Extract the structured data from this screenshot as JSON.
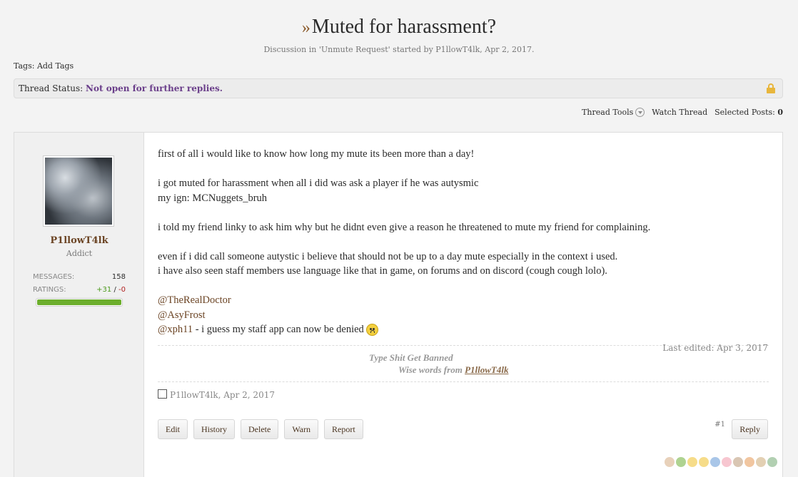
{
  "thread": {
    "prefix": "»",
    "title": "Muted for harassment?",
    "discussion_prefix": "Discussion in '",
    "forum": "Unmute Request",
    "started_by_prefix": "' started by ",
    "author": "P1llowT4lk",
    "date_sep": ", ",
    "date": "Apr 2, 2017",
    "date_end": "."
  },
  "tags": {
    "label": "Tags:",
    "add_label": "Add Tags"
  },
  "status": {
    "label": "Thread Status:",
    "value": "Not open for further replies."
  },
  "tools": {
    "thread_tools": "Thread Tools",
    "watch": "Watch Thread",
    "selected_label": "Selected Posts:",
    "selected_count": "0"
  },
  "user": {
    "name": "P1llowT4lk",
    "title": "Addict",
    "messages_label": "MESSAGES:",
    "messages": "158",
    "ratings_label": "RATINGS:",
    "ratings_pos": "+31",
    "ratings_sep": " / ",
    "ratings_neg": "-0",
    "rating_fraction": 1.0
  },
  "post": {
    "p1": "first of all i would like to know how long my mute its been more than a day!",
    "p2a": "i got muted for harassment when all i did was ask a player if he was autysmic",
    "p2b": "my ign: MCNuggets_bruh",
    "p3": "i told my friend linky to ask him why but he didnt even give a reason he threatened to mute my friend for complaining.",
    "p4a": "even if i did call someone autystic i believe that should not be up to a day mute especially in the context i used.",
    "p4b": "i have also seen staff members use language like that in game, on forums and on discord (cough cough lolo).",
    "mention1": "@TheRealDoctor",
    "mention2": "@AsyFrost",
    "mention3": "@xph11",
    "last_line": " - i guess my staff app can now be denied",
    "edited": "Last edited: Apr 3, 2017",
    "sig_line1": "Type Shit Get Banned",
    "sig_line2_prefix": "Wise words from ",
    "sig_line2_link": "P1llowT4lk",
    "meta_author": "P1llowT4lk",
    "meta_date": ", Apr 2, 2017",
    "number": "#1"
  },
  "buttons": {
    "edit": "Edit",
    "history": "History",
    "delete": "Delete",
    "warn": "Warn",
    "report": "Report",
    "reply": "Reply"
  },
  "reactions": [
    {
      "icon": "thumbs-up-icon",
      "color": "#d9b38c"
    },
    {
      "icon": "check-icon",
      "color": "#7ab648"
    },
    {
      "icon": "smile-icon",
      "color": "#f0c43a"
    },
    {
      "icon": "star-icon",
      "color": "#f0c43a"
    },
    {
      "icon": "info-icon",
      "color": "#6fa0d8"
    },
    {
      "icon": "heart-icon",
      "color": "#f2a0b0"
    },
    {
      "icon": "wrench-icon",
      "color": "#c0a080"
    },
    {
      "icon": "rainbow-icon",
      "color": "#e8a060"
    },
    {
      "icon": "pen-icon",
      "color": "#d0b080"
    },
    {
      "icon": "creeper-icon",
      "color": "#7fb07f"
    }
  ]
}
